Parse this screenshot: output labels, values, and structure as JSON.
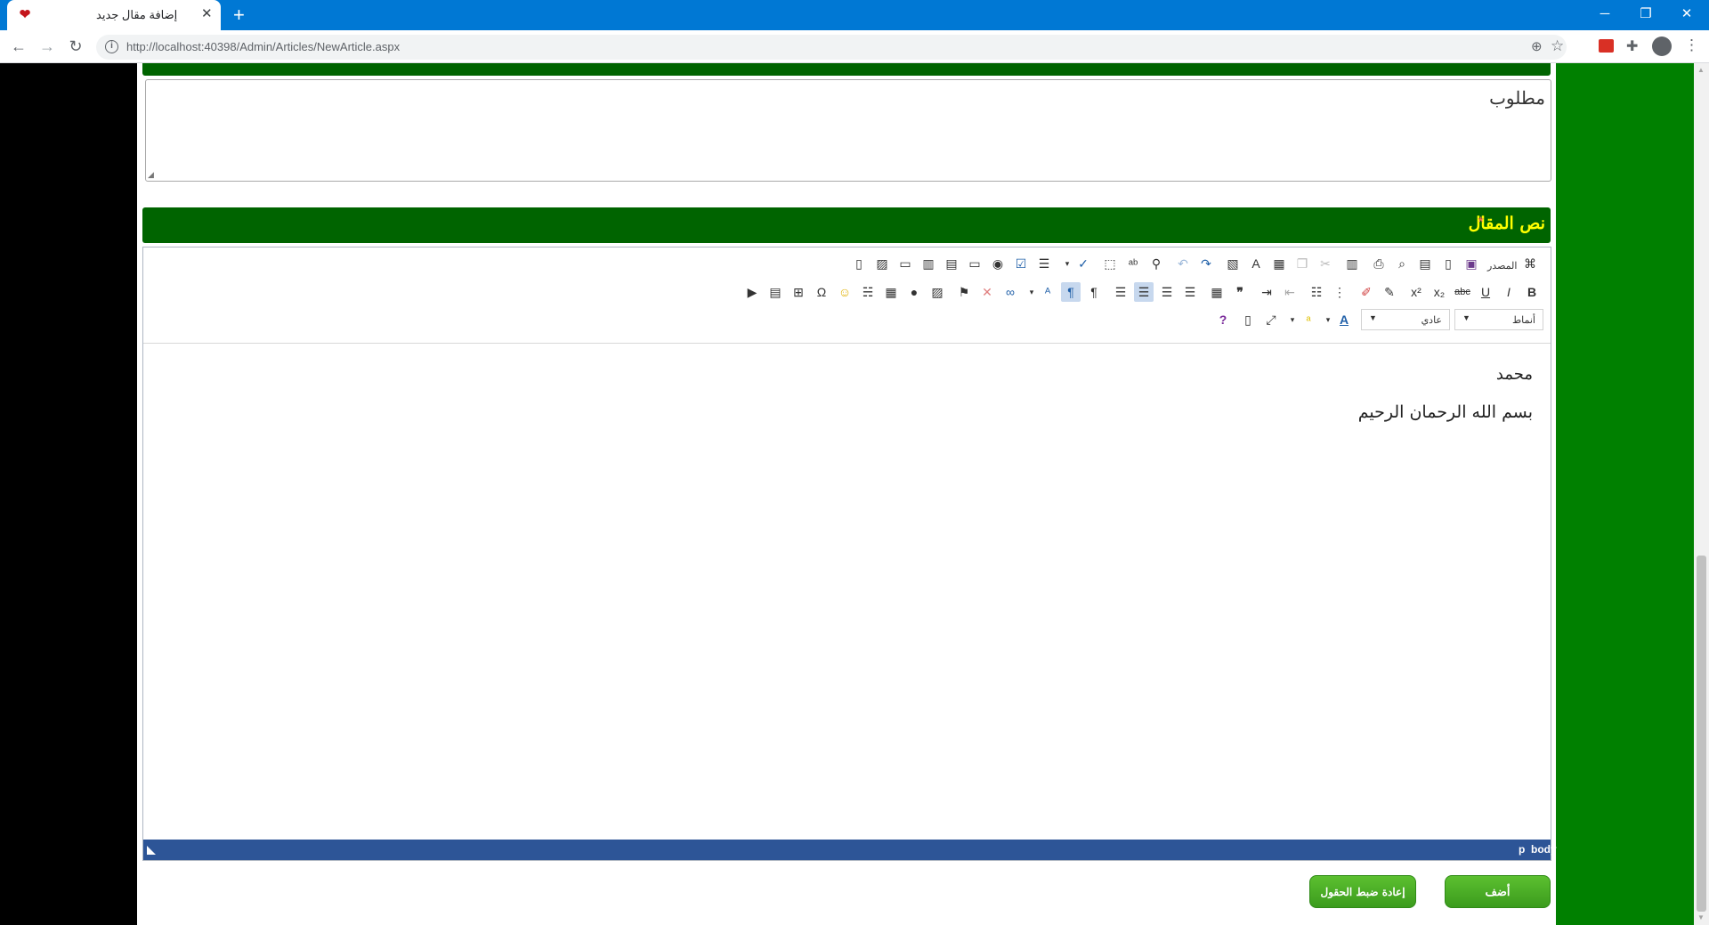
{
  "browser": {
    "tab_title": "إضافة مقال جديد",
    "tab_close": "✕",
    "new_tab": "+",
    "url": "http://localhost:40398/Admin/Articles/NewArticle.aspx",
    "minimize": "─",
    "restore": "❐",
    "close": "✕",
    "back": "←",
    "forward": "→",
    "reload": "↻",
    "info": "i",
    "zoom": "⊕",
    "star": "☆",
    "puzzle": "✚",
    "menu": "⋮"
  },
  "summary": {
    "placeholder_text": "مطلوب"
  },
  "article_body": {
    "label": "نص المقال",
    "required_marker": "*"
  },
  "editor": {
    "toolbar": {
      "source_label": "المصدر",
      "styles_label": "أنماط",
      "format_label": "عادي"
    },
    "content": {
      "line1": "محمد",
      "line2": "بسم الله الرحمان الرحيم"
    },
    "path": [
      "p",
      "body"
    ]
  },
  "buttons": {
    "add": "أضف",
    "reset": "إعادة ضبط الحقول"
  },
  "colors": {
    "header_green": "#006400",
    "side_green": "#008000",
    "label_yellow": "#ffff00",
    "editor_footer": "#2d5597",
    "button_green": "#4cae25"
  }
}
